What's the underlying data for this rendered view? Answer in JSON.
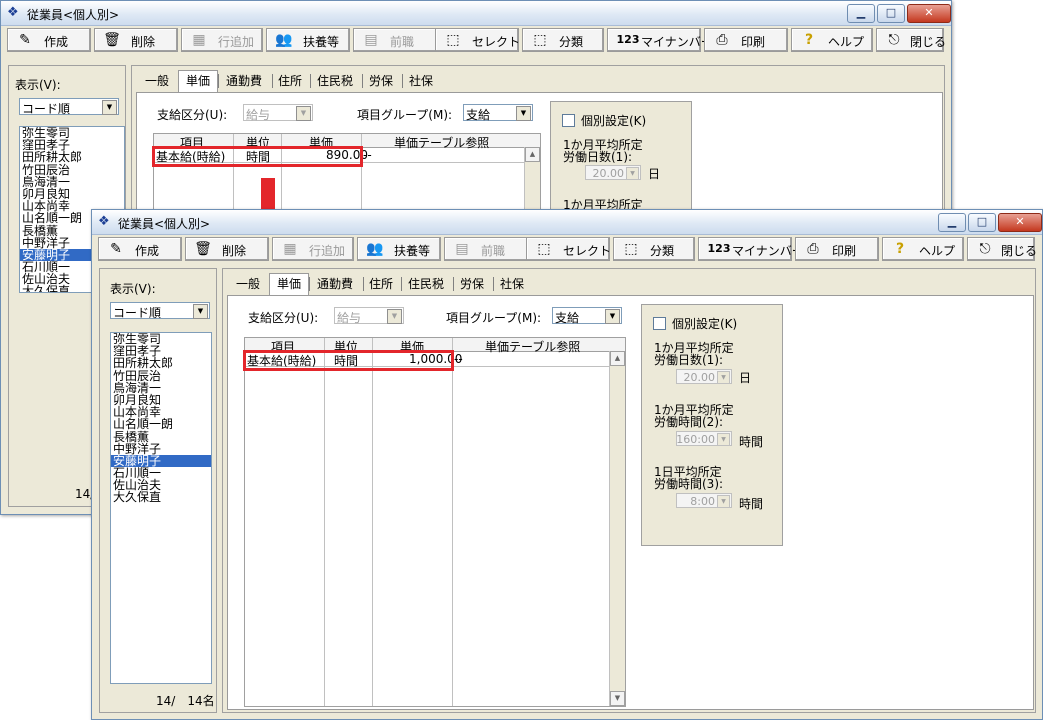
{
  "window_title": "従業員<個人別>",
  "toolbar": {
    "create": "作成",
    "delete": "削除",
    "add_row": "行追加",
    "dependents": "扶養等",
    "prev_job": "前職",
    "select": "セレクト",
    "category": "分類",
    "my_number": "マイナンバー",
    "print": "印刷",
    "help": "ヘルプ",
    "close": "閉じる"
  },
  "sidebar": {
    "display_label": "表示(V):",
    "sort_value": "コード順",
    "employees": [
      "弥生零司",
      "窪田孝子",
      "田所耕太郎",
      "竹田辰治",
      "鳥海清一",
      "卯月良知",
      "山本尚幸",
      "山名順一朗",
      "長橋薫",
      "中野洋子",
      "安藤明子",
      "石川順一",
      "佐山治夫",
      "大久保直"
    ],
    "selected_index": 10,
    "counter_back": "14/",
    "counter_front": "14/　14名"
  },
  "tabs": [
    "一般",
    "単価",
    "通勤費",
    "住所",
    "住民税",
    "労保",
    "社保"
  ],
  "active_tab": 1,
  "form": {
    "pay_class_label": "支給区分(U):",
    "pay_class_value": "給与",
    "item_group_label": "項目グループ(M):",
    "item_group_value": "支給"
  },
  "grid": {
    "headers": [
      "項目",
      "単位",
      "単価",
      "単価テーブル参照"
    ],
    "row_back": {
      "item": "基本給(時給)",
      "unit": "時間",
      "price": "890.00",
      "ref": "--"
    },
    "row_front": {
      "item": "基本給(時給)",
      "unit": "時間",
      "price": "1,000.00",
      "ref": "--"
    }
  },
  "individual": {
    "checkbox_label": "個別設定(K)",
    "days_label_1": "1か月平均所定",
    "days_label_2": "労働日数(1):",
    "days_value": "20.00",
    "days_unit": "日",
    "hours_label_1": "1か月平均所定",
    "hours_label_2": "労働時間(2):",
    "hours_value": "160:00",
    "hours_unit": "時間",
    "daily_label_1": "1日平均所定",
    "daily_label_2": "労働時間(3):",
    "daily_value": "8:00",
    "daily_unit": "時間",
    "back_partial": "1か月平均所定"
  },
  "colors": {
    "highlight_red": "#e3262b",
    "selection_blue": "#316ac5"
  }
}
